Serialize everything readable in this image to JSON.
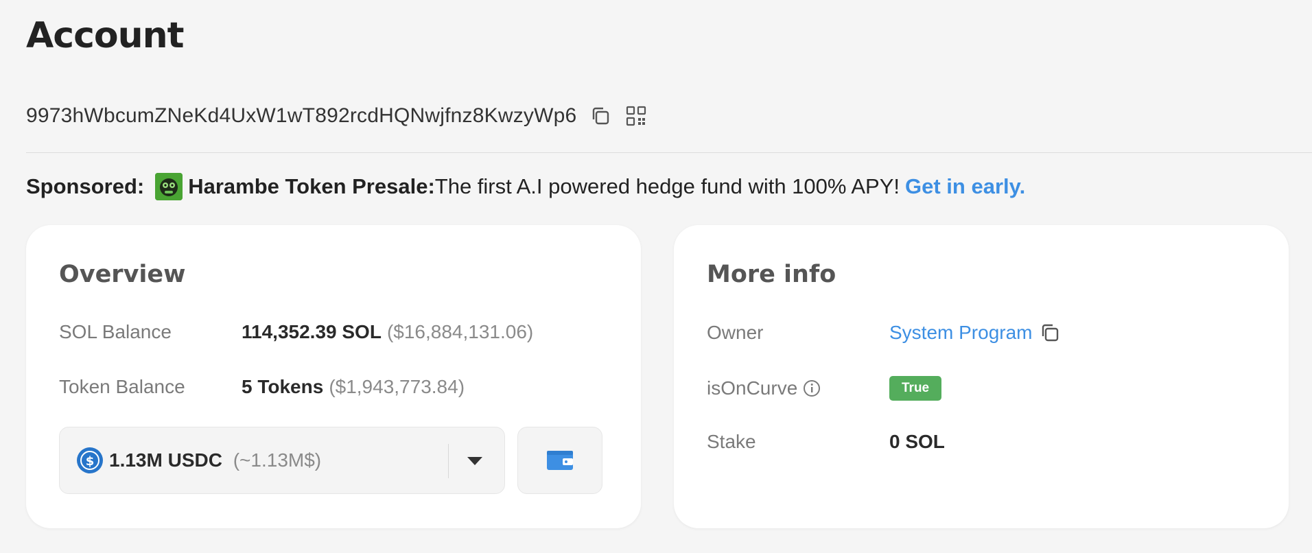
{
  "page": {
    "title": "Account"
  },
  "account": {
    "address": "9973hWbcumZNeKd4UxW1wT892rcdHQNwjfnz8KwzyWp6"
  },
  "sponsor": {
    "label": "Sponsored:",
    "name": "Harambe Token Presale:",
    "text": "The first A.I powered hedge fund with 100% APY!",
    "link": "Get in early."
  },
  "overview": {
    "title": "Overview",
    "sol_balance": {
      "label": "SOL Balance",
      "value": "114,352.39 SOL",
      "usd": "($16,884,131.06)"
    },
    "token_balance": {
      "label": "Token Balance",
      "value": "5 Tokens",
      "usd": "($1,943,773.84)"
    },
    "token_select": {
      "amount": "1.13M USDC",
      "usd": "(~1.13M$)"
    }
  },
  "more_info": {
    "title": "More info",
    "owner": {
      "label": "Owner",
      "value": "System Program"
    },
    "is_on_curve": {
      "label": "isOnCurve",
      "value": "True"
    },
    "stake": {
      "label": "Stake",
      "value": "0 SOL"
    }
  },
  "colors": {
    "accent": "#3d8fe3",
    "badge_green": "#54ad5c",
    "usdc_blue": "#2775ca",
    "background": "#f5f5f5"
  },
  "icons": {
    "copy": "copy-icon",
    "qr": "qr-code-icon",
    "info": "info-icon",
    "caret": "chevron-down-icon",
    "wallet": "wallet-icon",
    "usdc": "usdc-icon"
  }
}
